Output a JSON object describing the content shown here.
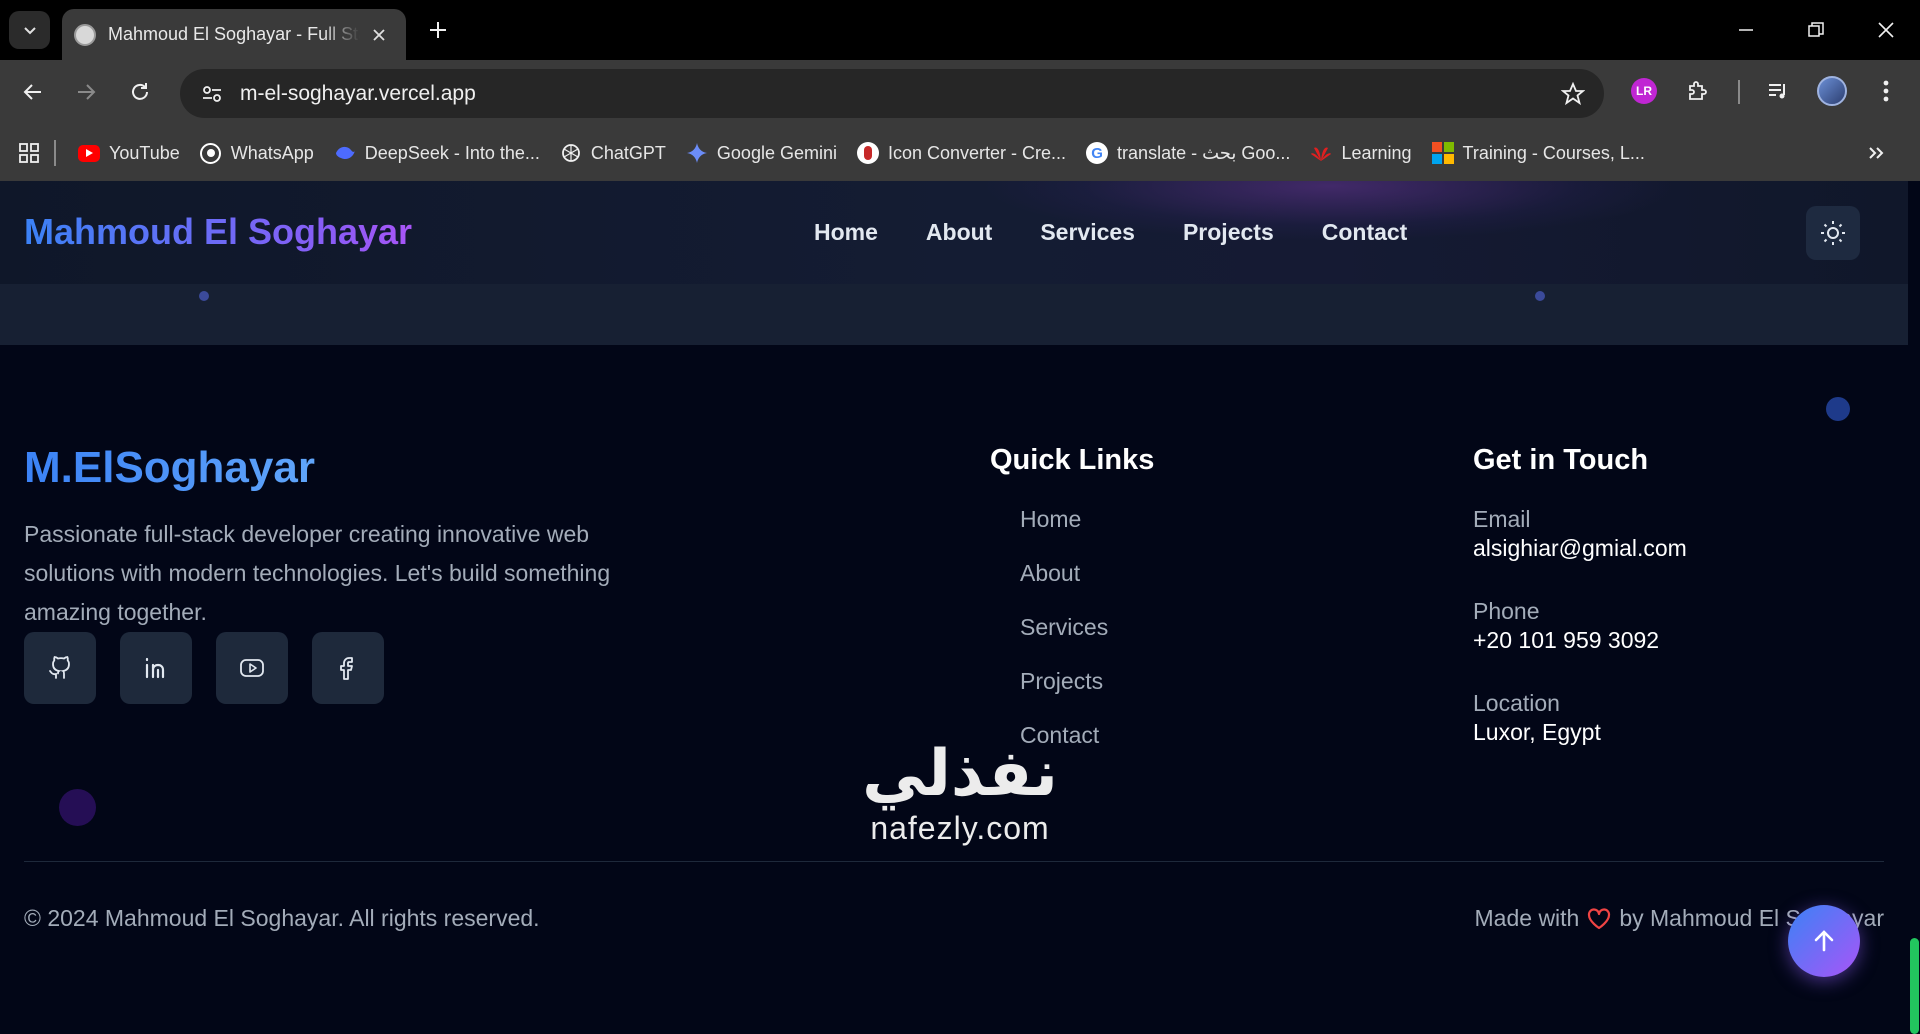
{
  "browser": {
    "tab_title": "Mahmoud El Soghayar - Full Stack",
    "url": "m-el-soghayar.vercel.app",
    "bookmarks": [
      {
        "label": "YouTube",
        "icon": "youtube-icon"
      },
      {
        "label": "WhatsApp",
        "icon": "whatsapp-icon"
      },
      {
        "label": "DeepSeek - Into the...",
        "icon": "deepseek-icon"
      },
      {
        "label": "ChatGPT",
        "icon": "chatgpt-icon"
      },
      {
        "label": "Google Gemini",
        "icon": "gemini-icon"
      },
      {
        "label": "Icon Converter - Cre...",
        "icon": "icon-converter-icon"
      },
      {
        "label": "translate - بحث Goo...",
        "icon": "google-icon"
      },
      {
        "label": "Learning",
        "icon": "huawei-icon"
      },
      {
        "label": "Training - Courses, L...",
        "icon": "microsoft-icon"
      }
    ]
  },
  "header": {
    "logo": "Mahmoud El Soghayar",
    "nav": [
      "Home",
      "About",
      "Services",
      "Projects",
      "Contact"
    ]
  },
  "footer": {
    "brand": "M.ElSoghayar",
    "description": "Passionate full-stack developer creating innovative web solutions with modern technologies. Let's build something amazing together.",
    "socials": [
      "github-icon",
      "linkedin-icon",
      "youtube-icon",
      "facebook-icon"
    ],
    "quick_links_title": "Quick Links",
    "quick_links": [
      "Home",
      "About",
      "Services",
      "Projects",
      "Contact"
    ],
    "contact_title": "Get in Touch",
    "contact": [
      {
        "label": "Email",
        "value": "alsighiar@gmial.com"
      },
      {
        "label": "Phone",
        "value": "+20 101 959 3092"
      },
      {
        "label": "Location",
        "value": "Luxor, Egypt"
      }
    ],
    "copyright": "© 2024 Mahmoud El Soghayar. All rights reserved.",
    "made_with_prefix": "Made with",
    "made_with_suffix": "by Mahmoud El Soghayar"
  },
  "watermark": {
    "arabic": "نفذلي",
    "latin": "nafezly.com"
  },
  "colors": {
    "accent_blue": "#3b82f6",
    "accent_purple": "#a855f7",
    "heart": "#ef4444",
    "page_bg": "#020617"
  }
}
